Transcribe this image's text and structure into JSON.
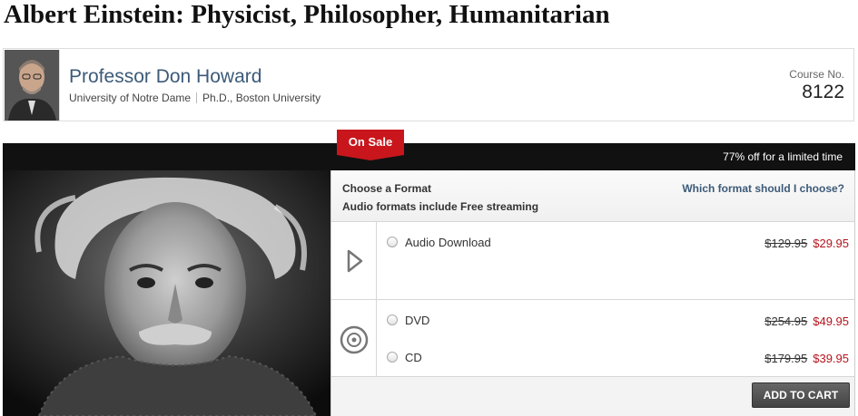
{
  "course": {
    "title": "Albert Einstein: Physicist, Philosopher, Humanitarian",
    "number_label": "Course No.",
    "number": "8122"
  },
  "professor": {
    "name": "Professor Don Howard",
    "university": "University of Notre Dame",
    "degree": "Ph.D., Boston University"
  },
  "sale": {
    "badge": "On Sale",
    "message": "77% off for a limited time"
  },
  "formats": {
    "heading": "Choose a Format",
    "audio_note": "Audio formats include Free streaming",
    "help_link": "Which format should I choose?",
    "options": [
      {
        "label": "Audio Download",
        "old_price": "$129.95",
        "price": "$29.95",
        "group_icon": "play-icon"
      },
      {
        "label": "DVD",
        "old_price": "$254.95",
        "price": "$49.95",
        "group_icon": "disc-icon"
      },
      {
        "label": "CD",
        "old_price": "$179.95",
        "price": "$39.95",
        "group_icon": "disc-icon"
      }
    ]
  },
  "cart": {
    "button": "ADD TO CART"
  },
  "colors": {
    "accent_link": "#3c5a78",
    "sale_red": "#c9161d",
    "price_red": "#b4141c",
    "bar_black": "#111111"
  }
}
